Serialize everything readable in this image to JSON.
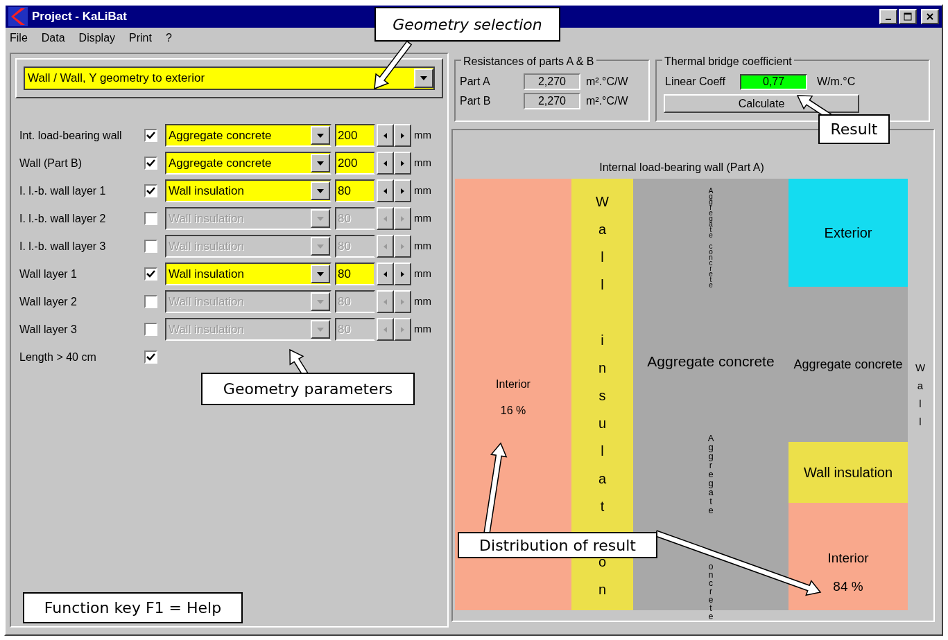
{
  "window": {
    "title": "Project - KaLiBat"
  },
  "menu": [
    {
      "label": "File"
    },
    {
      "label": "Data"
    },
    {
      "label": "Display"
    },
    {
      "label": "Print"
    },
    {
      "label": "?"
    }
  ],
  "geometry": {
    "value": "Wall / Wall, Y geometry to exterior"
  },
  "layers": [
    {
      "label": "Int. load-bearing wall",
      "checked": true,
      "material": "Aggregate concrete",
      "thickness": "200",
      "unit": "mm"
    },
    {
      "label": "Wall (Part B)",
      "checked": true,
      "material": "Aggregate concrete",
      "thickness": "200",
      "unit": "mm"
    },
    {
      "label": "I. l.-b. wall layer 1",
      "checked": true,
      "material": "Wall insulation",
      "thickness": "80",
      "unit": "mm"
    },
    {
      "label": "I. l.-b. wall layer 2",
      "checked": false,
      "material": "Wall insulation",
      "thickness": "80",
      "unit": "mm"
    },
    {
      "label": "I. l.-b. wall layer 3",
      "checked": false,
      "material": "Wall insulation",
      "thickness": "80",
      "unit": "mm"
    },
    {
      "label": "Wall layer 1",
      "checked": true,
      "material": "Wall insulation",
      "thickness": "80",
      "unit": "mm"
    },
    {
      "label": "Wall layer 2",
      "checked": false,
      "material": "Wall insulation",
      "thickness": "80",
      "unit": "mm"
    },
    {
      "label": "Wall layer 3",
      "checked": false,
      "material": "Wall insulation",
      "thickness": "80",
      "unit": "mm"
    }
  ],
  "length_option": {
    "label": "Length > 40 cm",
    "checked": true
  },
  "resistances": {
    "title": "Resistances of parts A & B",
    "rows": [
      {
        "label": "Part A",
        "value": "2,270",
        "unit": "m².°C/W"
      },
      {
        "label": "Part B",
        "value": "2,270",
        "unit": "m².°C/W"
      }
    ]
  },
  "thermal": {
    "title": "Thermal bridge coefficient",
    "label": "Linear Coeff",
    "value": "0,77",
    "unit": "W/m.°C",
    "button": "Calculate"
  },
  "diagram": {
    "header": "Internal load-bearing wall (Part A)",
    "interior_left": {
      "label": "Interior",
      "share": "16 %"
    },
    "insulation_letters": [
      "W",
      "a",
      "l",
      "l",
      "i",
      "n",
      "s",
      "u",
      "l",
      "a",
      "t",
      "o",
      "n"
    ],
    "concrete_column": {
      "top": "Aggregate concrete",
      "middle": "Aggregate concrete",
      "bottom_upper": "Aggregate",
      "bottom_lower": "oncrete"
    },
    "wall_column": {
      "exterior": "Exterior",
      "middle": "Aggregate concrete",
      "insulation": "Wall insulation",
      "interior_label": "Interior",
      "interior_share": "84 %"
    },
    "side_letters": [
      "W",
      "a",
      "l",
      "l"
    ]
  },
  "callouts": [
    {
      "text": "Geometry selection"
    },
    {
      "text": "Result"
    },
    {
      "text": "Geometry parameters"
    },
    {
      "text": "Function key F1 = Help"
    },
    {
      "text": "Distribution of result"
    }
  ]
}
